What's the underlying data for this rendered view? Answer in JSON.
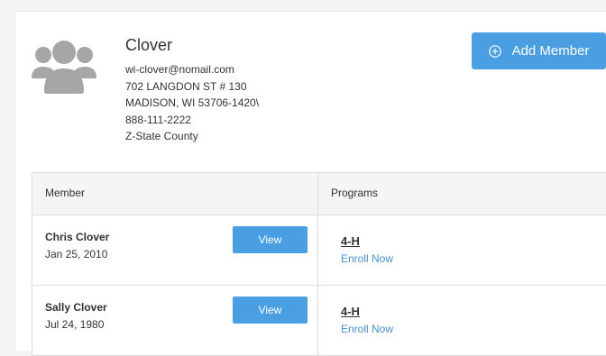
{
  "family": {
    "name": "Clover",
    "email": "wi-clover@nomail.com",
    "address_line1": "702 LANGDON ST # 130",
    "address_line2": "MADISON, WI 53706-1420\\",
    "phone": "888-111-2222",
    "county": "Z-State County"
  },
  "actions": {
    "add_member_label": "Add Member"
  },
  "table": {
    "headers": {
      "member": "Member",
      "programs": "Programs"
    },
    "rows": [
      {
        "name": "Chris Clover",
        "dob": "Jan 25, 2010",
        "view_label": "View",
        "program": "4-H",
        "enroll_label": "Enroll Now"
      },
      {
        "name": "Sally Clover",
        "dob": "Jul 24, 1980",
        "view_label": "View",
        "program": "4-H",
        "enroll_label": "Enroll Now"
      }
    ]
  },
  "icons": {
    "avatar": "family-avatar-icon",
    "add": "plus-circle-icon"
  },
  "colors": {
    "accent": "#4a9fe3",
    "link": "#4a8fcf",
    "avatar": "#a6a6a6"
  }
}
